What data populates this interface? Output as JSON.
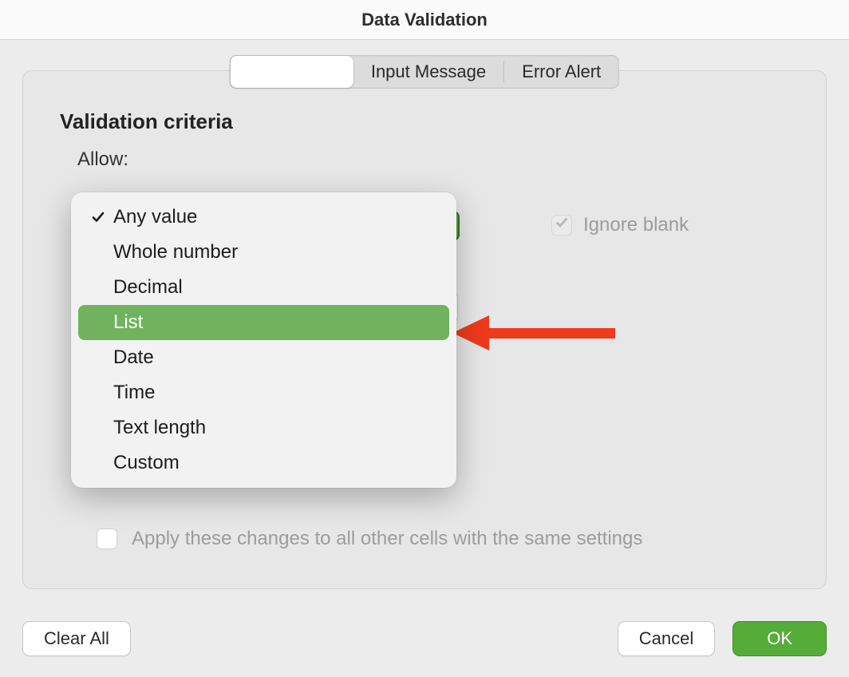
{
  "window": {
    "title": "Data Validation"
  },
  "tabs": {
    "items": [
      {
        "label": ""
      },
      {
        "label": "Input Message"
      },
      {
        "label": "Error Alert"
      }
    ],
    "selected_index": 0
  },
  "criteria": {
    "section_title": "Validation criteria",
    "allow_label": "Allow:",
    "options": [
      "Any value",
      "Whole number",
      "Decimal",
      "List",
      "Date",
      "Time",
      "Text length",
      "Custom"
    ],
    "current_value": "Any value",
    "highlighted_option": "List"
  },
  "checkboxes": {
    "ignore_blank": {
      "label": "Ignore blank",
      "checked": true,
      "enabled": false
    },
    "apply_all": {
      "label": "Apply these changes to all other cells with the same settings",
      "checked": false,
      "enabled": false
    }
  },
  "buttons": {
    "clear_all": "Clear All",
    "cancel": "Cancel",
    "ok": "OK"
  }
}
